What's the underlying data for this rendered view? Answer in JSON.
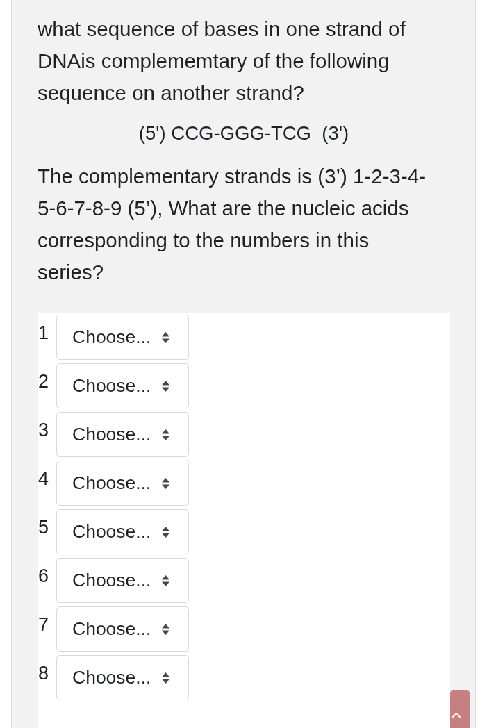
{
  "question": {
    "text": "what sequence of bases in one strand of DNAis complememtary of the following sequence on another strand?",
    "sequence": "(5') CCG-GGG-TCG  (3')",
    "prompt": "The complementary strands is (3’) 1-2-3-4-5-6-7-8-9 (5’), What are the nucleic acids corresponding to the numbers in this series?"
  },
  "answers": [
    {
      "number": "1",
      "placeholder": "Choose..."
    },
    {
      "number": "2",
      "placeholder": "Choose..."
    },
    {
      "number": "3",
      "placeholder": "Choose..."
    },
    {
      "number": "4",
      "placeholder": "Choose..."
    },
    {
      "number": "5",
      "placeholder": "Choose..."
    },
    {
      "number": "6",
      "placeholder": "Choose..."
    },
    {
      "number": "7",
      "placeholder": "Choose..."
    },
    {
      "number": "8",
      "placeholder": "Choose..."
    }
  ]
}
